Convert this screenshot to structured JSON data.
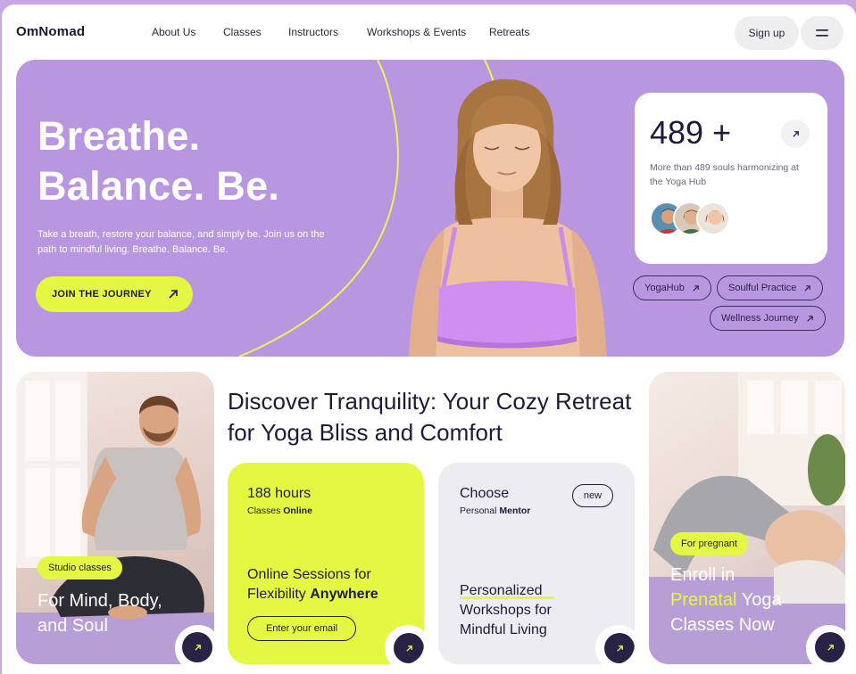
{
  "brand": {
    "logo": "OmNomad"
  },
  "nav": {
    "links": [
      "About Us",
      "Classes",
      "Instructors",
      "Workshops & Events",
      "Retreats"
    ],
    "signup": "Sign up"
  },
  "hero": {
    "title_line1": "Breathe.",
    "title_line2": "Balance. Be.",
    "text": "Take a breath, restore your balance, and simply be. Join us on the path to mindful living. Breathe. Balance. Be.",
    "cta": "JOIN THE JOURNEY",
    "stat": {
      "number": "489 +",
      "text": "More than 489 souls harmonizing at the Yoga Hub"
    },
    "pills": [
      "YogaHub",
      "Soulful Practice",
      "Wellness Journey"
    ]
  },
  "discover": {
    "heading": "Discover Tranquility: Your Cozy Retreat for Yoga Bliss and Comfort"
  },
  "left_photo": {
    "tag": "Studio classes",
    "caption_line1": "For Mind, Body,",
    "caption_line2": "and Soul"
  },
  "lime_card": {
    "hours": "188 hours",
    "small_prefix": "Classes ",
    "small_bold": "Online",
    "body_line1": "Online Sessions for",
    "body_line2_plain": "Flexibility ",
    "body_line2_bold": "Anywhere",
    "email_button": "Enter your email"
  },
  "grey_card": {
    "title": "Choose",
    "small_prefix": "Personal ",
    "small_bold": "Mentor",
    "new_tag": "new",
    "body_line1": "Personalized",
    "body_line2": "Workshops for",
    "body_line3": "Mindful Living"
  },
  "right_photo": {
    "tag": "For pregnant",
    "line1": "Enroll in",
    "line2_accent": "Prenatal",
    "line2_rest": " Yoga",
    "line3": "Classes Now"
  },
  "colors": {
    "lavender": "#b996e0",
    "lime": "#e4f743",
    "dark": "#2a2245"
  }
}
